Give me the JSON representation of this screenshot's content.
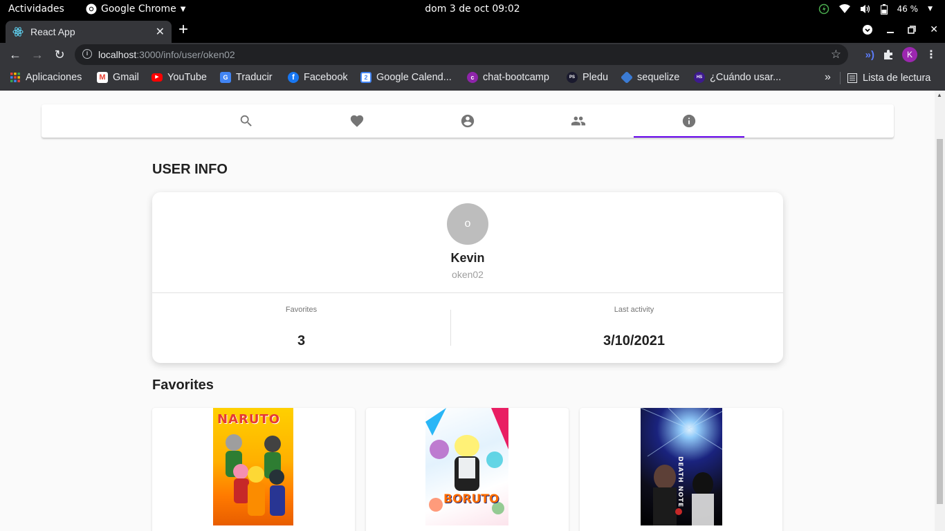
{
  "system": {
    "activities": "Actividades",
    "app_name": "Google Chrome",
    "clock": "dom  3 de oct  09:02",
    "battery": "46 %"
  },
  "browser": {
    "tab_title": "React App",
    "url_host": "localhost",
    "url_path": ":3000/info/user/oken02",
    "profile_initial": "K",
    "bookmarks": [
      {
        "label": "Aplicaciones",
        "icon": "apps-grid-icon"
      },
      {
        "label": "Gmail",
        "icon": "gmail-icon"
      },
      {
        "label": "YouTube",
        "icon": "youtube-icon"
      },
      {
        "label": "Traducir",
        "icon": "translate-icon"
      },
      {
        "label": "Facebook",
        "icon": "facebook-icon"
      },
      {
        "label": "Google Calend...",
        "icon": "calendar-icon"
      },
      {
        "label": "chat-bootcamp",
        "icon": "chat-icon"
      },
      {
        "label": "Pledu",
        "icon": "pledu-icon"
      },
      {
        "label": "sequelize",
        "icon": "sequelize-icon"
      },
      {
        "label": "¿Cuándo usar...",
        "icon": "hs-icon"
      }
    ],
    "reading_list": "Lista de lectura"
  },
  "nav": {
    "tabs": [
      {
        "icon": "search-icon"
      },
      {
        "icon": "heart-icon"
      },
      {
        "icon": "account-circle-icon"
      },
      {
        "icon": "people-icon"
      },
      {
        "icon": "info-icon"
      }
    ],
    "active_index": 4,
    "accent_color": "#6200ea"
  },
  "user_info": {
    "title": "USER INFO",
    "avatar_letter": "o",
    "name": "Kevin",
    "username": "oken02",
    "favorites_label": "Favorites",
    "favorites_count": "3",
    "last_activity_label": "Last activity",
    "last_activity": "3/10/2021"
  },
  "favorites": {
    "title": "Favorites",
    "items": [
      {
        "poster_text": "NARUTO"
      },
      {
        "poster_text": "BORUTO"
      },
      {
        "poster_text": "DEATH NOTE"
      }
    ]
  }
}
